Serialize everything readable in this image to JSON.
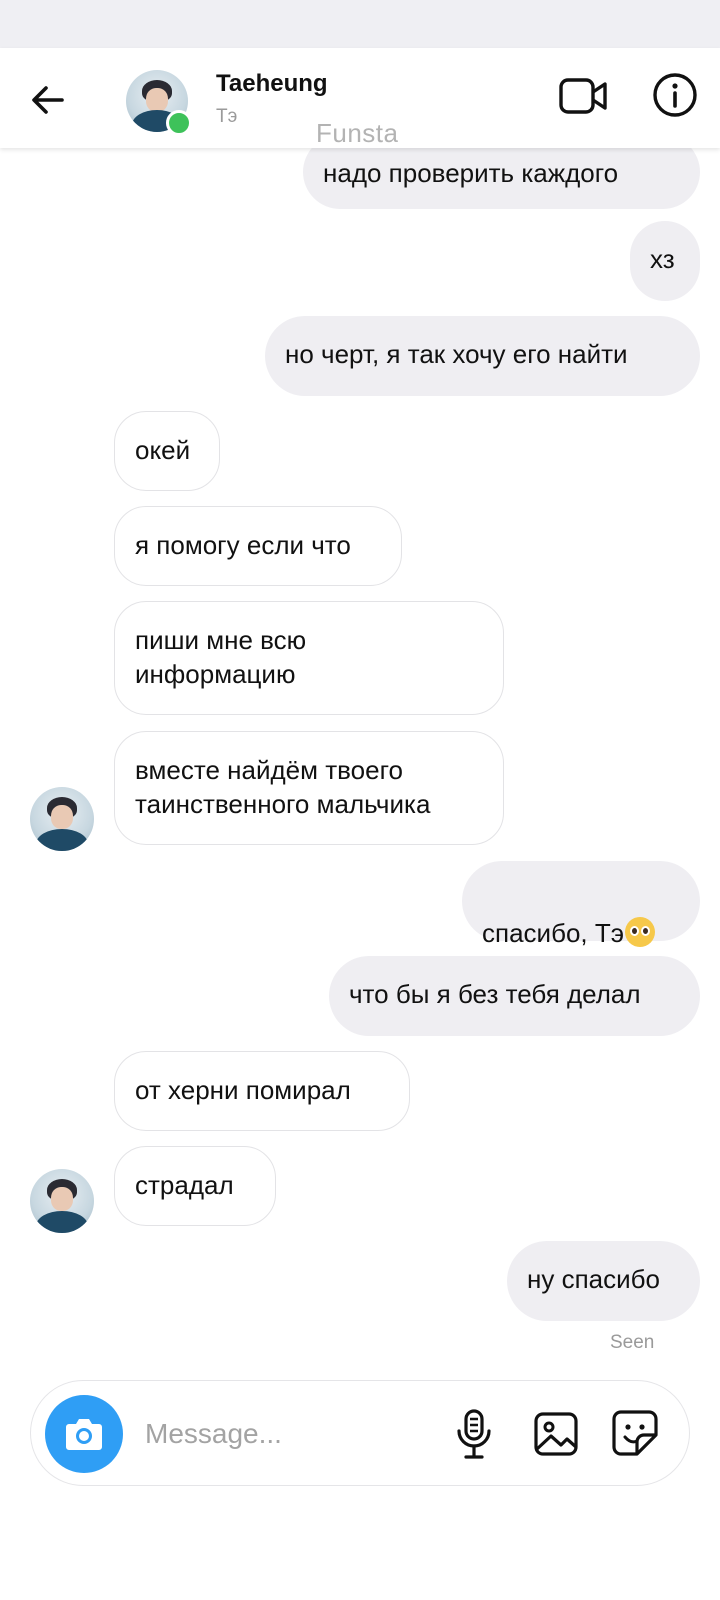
{
  "header": {
    "contact_name": "Taeheung",
    "contact_subtitle": "Тэ",
    "online": true
  },
  "watermark": "Funsta",
  "messages": [
    {
      "from": "me",
      "text": "надо проверить каждого"
    },
    {
      "from": "me",
      "text": "хз"
    },
    {
      "from": "me",
      "text": "но черт, я так хочу его найти"
    },
    {
      "from": "them",
      "text": "окей"
    },
    {
      "from": "them",
      "text": "я помогу если что"
    },
    {
      "from": "them",
      "text": "пиши мне всю\nинформацию"
    },
    {
      "from": "them",
      "text": "вместе найдём твоего\nтаинственного мальчика",
      "avatar": true
    },
    {
      "from": "me",
      "text": "спасибо, Тэ",
      "emoji": "pleading-face"
    },
    {
      "from": "me",
      "text": "что бы я без тебя делал"
    },
    {
      "from": "them",
      "text": "от херни помирал"
    },
    {
      "from": "them",
      "text": "страдал",
      "avatar": true
    },
    {
      "from": "me",
      "text": "ну спасибо"
    }
  ],
  "seen_label": "Seen",
  "composer": {
    "placeholder": "Message..."
  },
  "icons": {
    "back": "arrow-left-icon",
    "video": "video-camera-icon",
    "info": "info-icon",
    "camera": "camera-icon",
    "mic": "microphone-icon",
    "gallery": "image-icon",
    "sticker": "sticker-icon"
  },
  "colors": {
    "accent": "#2f9ef5",
    "online": "#3ec25a",
    "outgoing_bubble": "#efeef2"
  }
}
